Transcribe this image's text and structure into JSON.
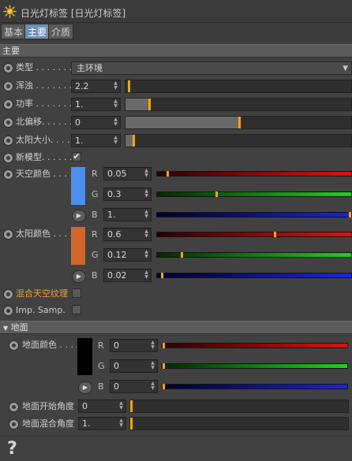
{
  "window": {
    "title": "日光灯标签 [日光灯标签]",
    "icon": "sun-icon"
  },
  "tabs": [
    {
      "label": "基本",
      "active": false
    },
    {
      "label": "主要",
      "active": true
    },
    {
      "label": "介质",
      "active": false
    }
  ],
  "main_section": {
    "header": "主要",
    "type": {
      "label": "类型 . . . . . . .",
      "value": "主环境"
    },
    "turbidity": {
      "label": "浑浊 . . . . . . .",
      "value": "2.2",
      "level": 0.01
    },
    "power": {
      "label": "功率 . . . . . . .",
      "value": "1.",
      "level": 0.1
    },
    "north_offset": {
      "label": "北偏移. . . . . .",
      "value": "0",
      "level": 0.5
    },
    "sun_size": {
      "label": "太阳大小. . . . .",
      "value": "1.",
      "level": 0.03
    },
    "new_model": {
      "label": "新模型. . . . . .",
      "checked": true,
      "check_glyph": "✔"
    },
    "sky_color": {
      "label": "天空颜色 . . . .",
      "swatch_color": "#4d8ef0",
      "channels": [
        {
          "name": "R",
          "value": "0.05",
          "level": 0.05
        },
        {
          "name": "G",
          "value": "0.3",
          "level": 0.3
        },
        {
          "name": "B",
          "value": "1.",
          "level": 1.0
        }
      ]
    },
    "sun_color": {
      "label": "太阳颜色 . . . .",
      "swatch_color": "#d3662a",
      "channels": [
        {
          "name": "R",
          "value": "0.6",
          "level": 0.6
        },
        {
          "name": "G",
          "value": "0.12",
          "level": 0.12
        },
        {
          "name": "B",
          "value": "0.02",
          "level": 0.02
        }
      ]
    },
    "mix_sky_texture": {
      "label": "混合天空纹理",
      "checked": false
    },
    "imp_samp": {
      "label": "Imp. Samp.",
      "checked": false
    }
  },
  "ground_section": {
    "header": "地面",
    "ground_color": {
      "label": "地面颜色 . . . .",
      "swatch_color": "#000000",
      "channels": [
        {
          "name": "R",
          "value": "0",
          "level": 0.0
        },
        {
          "name": "G",
          "value": "0",
          "level": 0.0
        },
        {
          "name": "B",
          "value": "0",
          "level": 0.0
        }
      ]
    },
    "start_angle": {
      "label": "地面开始角度",
      "value": "0",
      "level": 0.0
    },
    "blend_angle": {
      "label": "地面混合角度",
      "value": "1.",
      "level": 0.0
    }
  },
  "footer": {
    "help_glyph": "?"
  },
  "colors": {
    "accent_knob": "#f2a516",
    "active_tab": "#6e8fb3",
    "orange_label": "#e8a235"
  }
}
